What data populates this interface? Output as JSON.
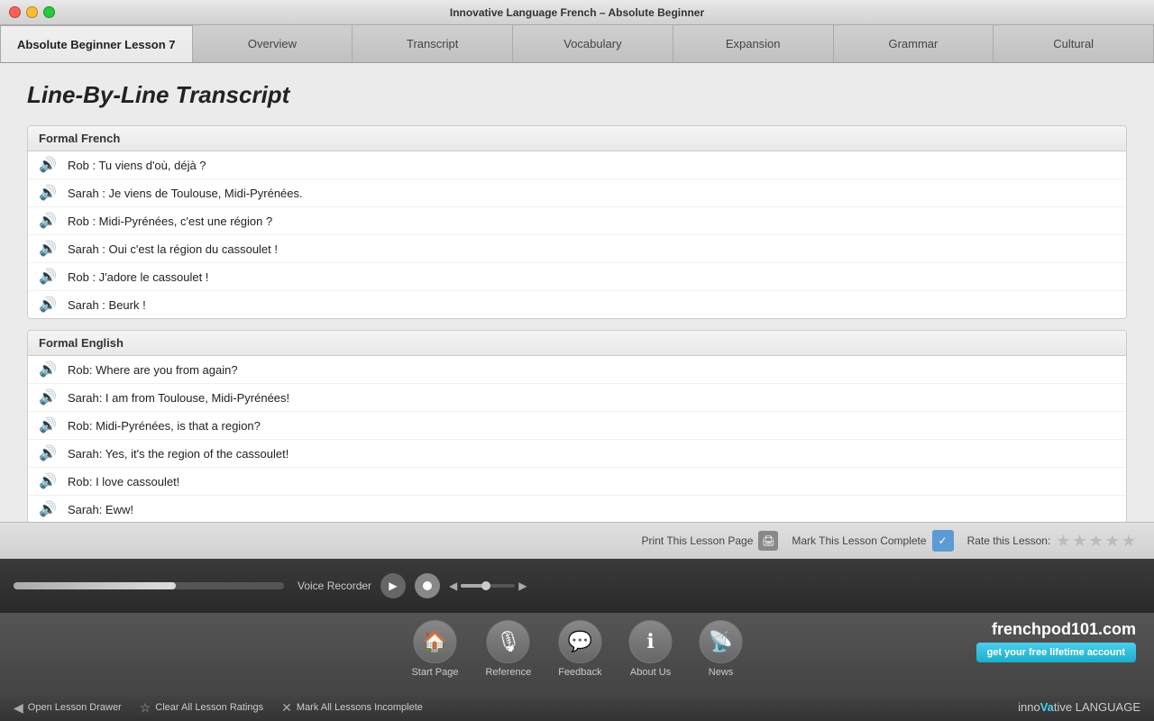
{
  "window": {
    "title": "Innovative Language French – Absolute Beginner"
  },
  "tabs": {
    "active": "Absolute Beginner Lesson 7",
    "items": [
      "Overview",
      "Transcript",
      "Vocabulary",
      "Expansion",
      "Grammar",
      "Cultural"
    ]
  },
  "page": {
    "title": "Line-By-Line Transcript"
  },
  "transcript": {
    "french_section_header": "Formal French",
    "french_lines": [
      "Rob : Tu viens d'où, déjà ?",
      "Sarah : Je viens de Toulouse, Midi-Pyrénées.",
      "Rob : Midi-Pyrénées, c'est une région ?",
      "Sarah : Oui c'est la région du cassoulet !",
      "Rob : J'adore le cassoulet !",
      "Sarah : Beurk !"
    ],
    "english_section_header": "Formal English",
    "english_lines": [
      "Rob: Where are you from again?",
      "Sarah: I am from Toulouse, Midi-Pyrénées!",
      "Rob: Midi-Pyrénées, is that a region?",
      "Sarah: Yes, it's the region of the cassoulet!",
      "Rob: I love cassoulet!",
      "Sarah: Eww!"
    ]
  },
  "toolbar": {
    "print_label": "Print This Lesson Page",
    "complete_label": "Mark This Lesson Complete",
    "rate_label": "Rate this Lesson:"
  },
  "audio": {
    "voice_recorder_label": "Voice Recorder"
  },
  "nav": {
    "items": [
      {
        "label": "Start Page",
        "icon": "🏠"
      },
      {
        "label": "Reference",
        "icon": "🎙"
      },
      {
        "label": "Feedback",
        "icon": "💬"
      },
      {
        "label": "About Us",
        "icon": "ℹ"
      },
      {
        "label": "News",
        "icon": "📡"
      }
    ]
  },
  "brand": {
    "name": "frenchpod101.com",
    "free_account": "get your free lifetime account"
  },
  "statusbar": {
    "open_drawer": "Open Lesson Drawer",
    "clear_ratings": "Clear All Lesson Ratings",
    "mark_incomplete": "Mark All Lessons Incomplete"
  },
  "inno_brand": "innoVative LANGUAGE"
}
